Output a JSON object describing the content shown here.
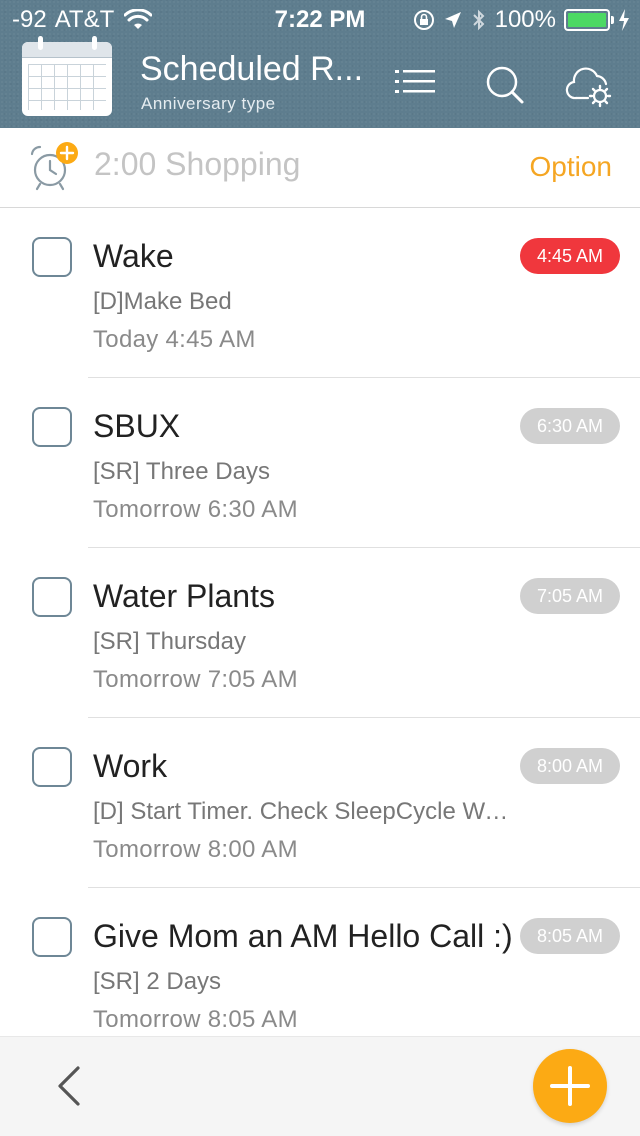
{
  "status_bar": {
    "signal": "-92",
    "carrier": "AT&T",
    "time": "7:22 PM",
    "battery_text": "100%",
    "battery_level": 1.0,
    "battery_color": "#4cd964"
  },
  "header": {
    "title": "Scheduled R...",
    "subtitle": "Anniversary type",
    "icons": [
      "calendar-icon",
      "list-icon",
      "search-icon",
      "cloud-settings-icon"
    ]
  },
  "quick_add": {
    "placeholder": "2:00 Shopping",
    "option_label": "Option",
    "accent_color": "#f5a623"
  },
  "tasks": [
    {
      "title": "Wake",
      "note": "[D]Make Bed",
      "date": "Today 4:45 AM",
      "time": "4:45 AM",
      "overdue": true
    },
    {
      "title": "SBUX",
      "note": "[SR] Three Days",
      "date": "Tomorrow 6:30 AM",
      "time": "6:30 AM",
      "overdue": false
    },
    {
      "title": "Water Plants",
      "note": "[SR] Thursday",
      "date": "Tomorrow 7:05 AM",
      "time": "7:05 AM",
      "overdue": false
    },
    {
      "title": "Work",
      "note": "[D] Start Timer. Check SleepCycle Wa...",
      "date": "Tomorrow 8:00 AM",
      "time": "8:00 AM",
      "overdue": false
    },
    {
      "title": "Give Mom an AM Hello Call :)",
      "note": "[SR] 2 Days",
      "date": "Tomorrow 8:05 AM",
      "time": "8:05 AM",
      "overdue": false
    }
  ],
  "colors": {
    "header_bg": "#5e7d8e",
    "overdue_pill": "#f0373d",
    "normal_pill": "#d0d0d0",
    "add_button": "#fcaa14"
  },
  "bottom_bar": {
    "icons": [
      "back-chevron-icon",
      "plus-icon"
    ]
  }
}
